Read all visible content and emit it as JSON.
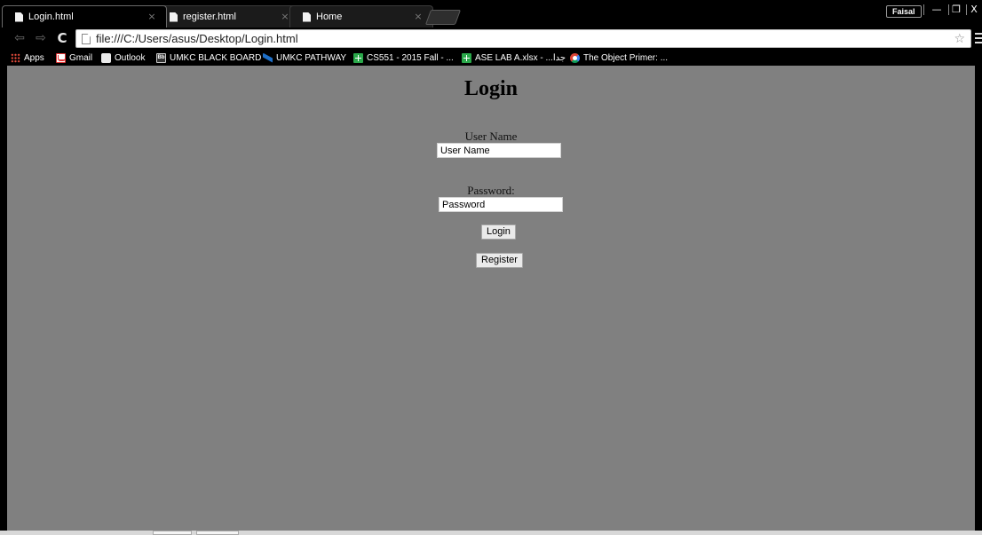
{
  "browser": {
    "tabs": [
      {
        "label": "Login.html",
        "active": true
      },
      {
        "label": "register.html",
        "active": false
      },
      {
        "label": "Home",
        "active": false
      }
    ],
    "tab_close_glyph": "×",
    "profile_name": "Faisal",
    "window_controls": {
      "minimize": "—",
      "restore": "❐",
      "close": "X"
    },
    "url": "file:///C:/Users/asus/Desktop/Login.html",
    "bookmarks": [
      {
        "label": "Apps",
        "icon": "apps-grid-icon"
      },
      {
        "label": "Gmail",
        "icon": "gmail-icon"
      },
      {
        "label": "Outlook",
        "icon": "outlook-icon"
      },
      {
        "label": "UMKC BLACK BOARD",
        "icon": "blackboard-icon"
      },
      {
        "label": "UMKC PATHWAY",
        "icon": "pathway-icon"
      },
      {
        "label": "CS551 - 2015 Fall - ...",
        "icon": "sheets-icon"
      },
      {
        "label": "ASE LAB A.xlsx - ...جدا",
        "icon": "sheets-icon"
      },
      {
        "label": "The Object Primer: ...",
        "icon": "google-icon"
      }
    ]
  },
  "page": {
    "title": "Login",
    "username": {
      "label": "User Name",
      "placeholder": "User Name"
    },
    "password": {
      "label": "Password:",
      "placeholder": "Password"
    },
    "login_label": "Login",
    "register_label": "Register",
    "background_color": "#808080"
  }
}
